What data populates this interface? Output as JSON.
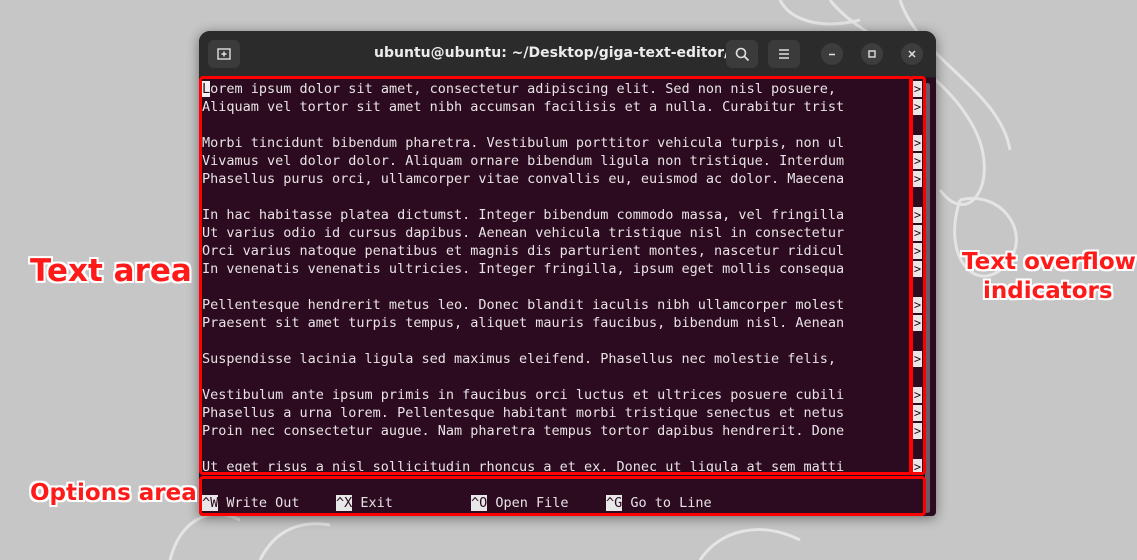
{
  "window": {
    "title": "ubuntu@ubuntu: ~/Desktop/giga-text-editor/bin"
  },
  "terminal": {
    "lines": [
      "Lorem ipsum dolor sit amet, consectetur adipiscing elit. Sed non nisl posuere,",
      "Aliquam vel tortor sit amet nibh accumsan facilisis et a nulla. Curabitur trist",
      "",
      "Morbi tincidunt bibendum pharetra. Vestibulum porttitor vehicula turpis, non ul",
      "Vivamus vel dolor dolor. Aliquam ornare bibendum ligula non tristique. Interdum",
      "Phasellus purus orci, ullamcorper vitae convallis eu, euismod ac dolor. Maecena",
      "",
      "In hac habitasse platea dictumst. Integer bibendum commodo massa, vel fringilla",
      "Ut varius odio id cursus dapibus. Aenean vehicula tristique nisl in consectetur",
      "Orci varius natoque penatibus et magnis dis parturient montes, nascetur ridicul",
      "In venenatis venenatis ultricies. Integer fringilla, ipsum eget mollis consequa",
      "",
      "Pellentesque hendrerit metus leo. Donec blandit iaculis nibh ullamcorper molest",
      "Praesent sit amet turpis tempus, aliquet mauris faucibus, bibendum nisl. Aenean",
      "",
      "Suspendisse lacinia ligula sed maximus eleifend. Phasellus nec molestie felis, ",
      "",
      "Vestibulum ante ipsum primis in faucibus orci luctus et ultrices posuere cubili",
      "Phasellus a urna lorem. Pellentesque habitant morbi tristique senectus et netus",
      "Proin nec consectetur augue. Nam pharetra tempus tortor dapibus hendrerit. Done",
      "",
      "Ut eget risus a nisl sollicitudin rhoncus a et ex. Donec ut ligula at sem matti"
    ],
    "overflow_indicator": ">"
  },
  "options": [
    {
      "key": "^W",
      "label": " Write Out"
    },
    {
      "key": "^X",
      "label": " Exit"
    },
    {
      "key": "^O",
      "label": " Open File"
    },
    {
      "key": "^G",
      "label": " Go to Line"
    }
  ],
  "annotations": {
    "text_area": "Text area",
    "overflow_line1": "Text overflow",
    "overflow_line2": "indicators",
    "options_area": "Options area"
  },
  "colors": {
    "terminal_bg": "#2c0a1f",
    "annotation": "#ff0000"
  }
}
